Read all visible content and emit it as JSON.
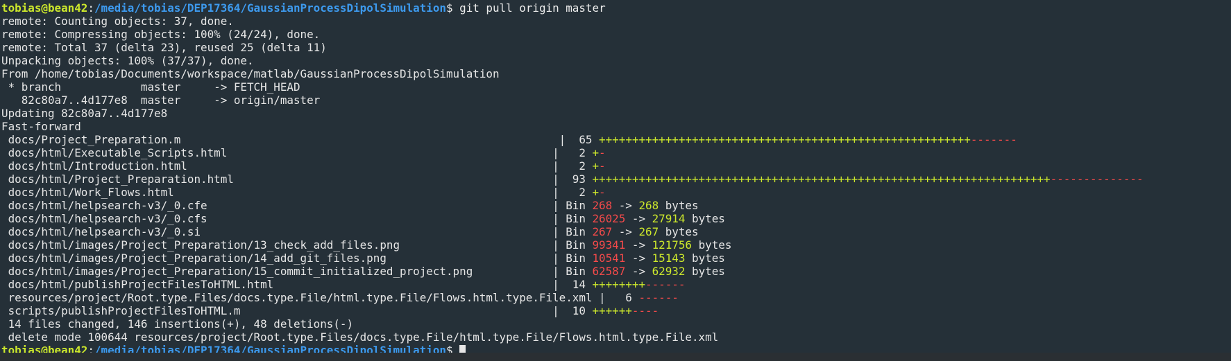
{
  "prompt": {
    "user_host": "tobias@bean42",
    "colon": ":",
    "path": "/media/tobias/DEP17364/GaussianProcessDipolSimulation",
    "dollar": "$ ",
    "command": "git pull origin master",
    "dollar_final": "$ "
  },
  "header_lines": [
    "remote: Counting objects: 37, done.",
    "remote: Compressing objects: 100% (24/24), done.",
    "remote: Total 37 (delta 23), reused 25 (delta 11)",
    "Unpacking objects: 100% (37/37), done.",
    "From /home/tobias/Documents/workspace/matlab/GaussianProcessDipolSimulation",
    " * branch            master     -> FETCH_HEAD",
    "   82c80a7..4d177e8  master     -> origin/master",
    "Updating 82c80a7..4d177e8",
    "Fast-forward"
  ],
  "diffstat": [
    {
      "file": " docs/Project_Preparation.m                                                         ",
      "sep": "|  65 ",
      "plus": "++++++++++++++++++++++++++++++++++++++++++++++++++++++++",
      "minus": "-------"
    },
    {
      "file": " docs/html/Executable_Scripts.html                                                 ",
      "sep": "|   2 ",
      "plus": "+",
      "minus": "-"
    },
    {
      "file": " docs/html/Introduction.html                                                       ",
      "sep": "|   2 ",
      "plus": "+",
      "minus": "-"
    },
    {
      "file": " docs/html/Project_Preparation.html                                                ",
      "sep": "|  93 ",
      "plus": "+++++++++++++++++++++++++++++++++++++++++++++++++++++++++++++++++++++",
      "minus": "--------------"
    },
    {
      "file": " docs/html/Work_Flows.html                                                         ",
      "sep": "|   2 ",
      "plus": "+",
      "minus": "-"
    },
    {
      "file": " docs/html/helpsearch-v3/_0.cfe                                                    ",
      "sep": "| Bin ",
      "old": "268",
      "arrow": " -> ",
      "new": "268",
      "unit": " bytes"
    },
    {
      "file": " docs/html/helpsearch-v3/_0.cfs                                                    ",
      "sep": "| Bin ",
      "old": "26025",
      "arrow": " -> ",
      "new": "27914",
      "unit": " bytes"
    },
    {
      "file": " docs/html/helpsearch-v3/_0.si                                                     ",
      "sep": "| Bin ",
      "old": "267",
      "arrow": " -> ",
      "new": "267",
      "unit": " bytes"
    },
    {
      "file": " docs/html/images/Project_Preparation/13_check_add_files.png                       ",
      "sep": "| Bin ",
      "old": "99341",
      "arrow": " -> ",
      "new": "121756",
      "unit": " bytes"
    },
    {
      "file": " docs/html/images/Project_Preparation/14_add_git_files.png                         ",
      "sep": "| Bin ",
      "old": "10541",
      "arrow": " -> ",
      "new": "15143",
      "unit": " bytes"
    },
    {
      "file": " docs/html/images/Project_Preparation/15_commit_initialized_project.png            ",
      "sep": "| Bin ",
      "old": "62587",
      "arrow": " -> ",
      "new": "62932",
      "unit": " bytes"
    },
    {
      "file": " docs/html/publishProjectFilesToHTML.html                                          ",
      "sep": "|  14 ",
      "plus": "++++++++",
      "minus": "------"
    },
    {
      "file": " resources/project/Root.type.Files/docs.type.File/html.type.File/Flows.html.type.File.xml ",
      "sep": "|   6 ",
      "plus": "",
      "minus": "------"
    },
    {
      "file": " scripts/publishProjectFilesToHTML.m                                               ",
      "sep": "|  10 ",
      "plus": "++++++",
      "minus": "----"
    }
  ],
  "summary_lines": [
    " 14 files changed, 146 insertions(+), 48 deletions(-)",
    " delete mode 100644 resources/project/Root.type.Files/docs.type.File/html.type.File/Flows.html.type.File.xml"
  ]
}
